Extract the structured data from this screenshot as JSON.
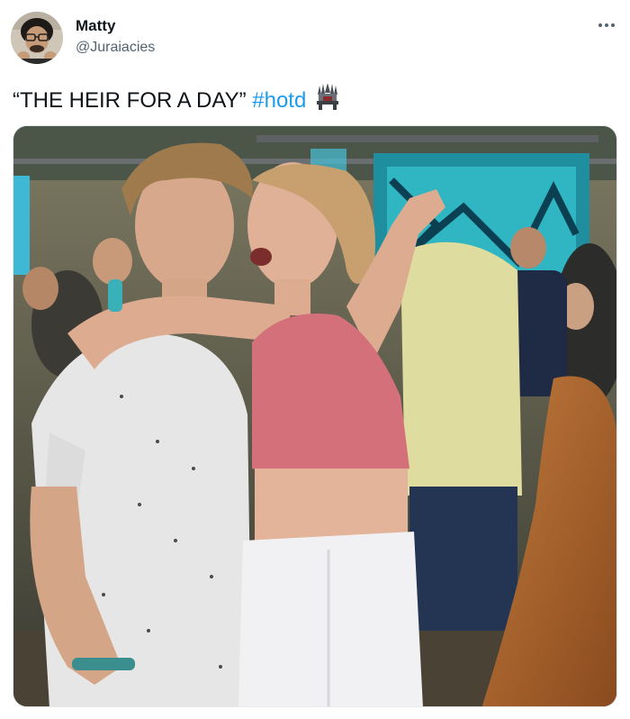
{
  "tweet": {
    "author": {
      "display_name": "Matty",
      "handle": "@Juraiacies",
      "avatar_icon": "user-avatar-icon"
    },
    "text": {
      "quote": "“THE HEIR FOR A DAY”",
      "hashtag": "#hotd",
      "emoji": "iron-throne-emoji-icon"
    },
    "more_icon": "more-dots-icon",
    "media": {
      "kind": "photo",
      "description_icon": "concert-photo"
    }
  },
  "colors": {
    "text": "#0f1419",
    "secondary": "#536471",
    "link": "#1d9bf0"
  }
}
